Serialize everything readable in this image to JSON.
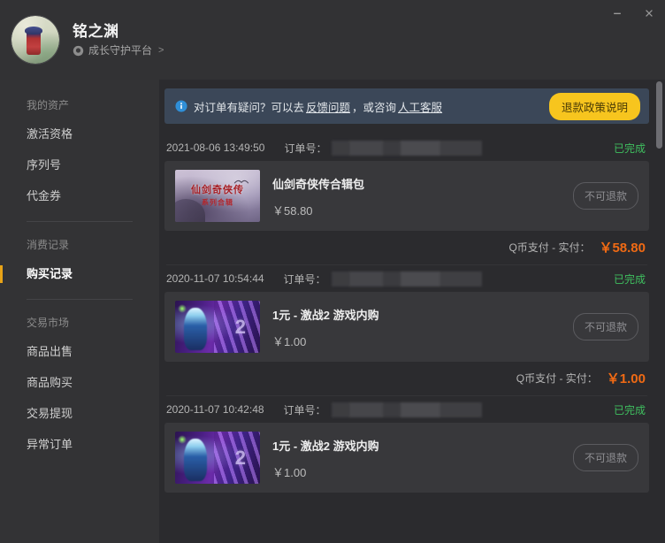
{
  "window": {
    "minimize_label": "–",
    "close_label": "✕"
  },
  "profile": {
    "nickname": "铭之渊",
    "platform_label": "成长守护平台",
    "platform_arrow": ">",
    "avatar_name": "user-avatar"
  },
  "sidebar": {
    "groups": [
      {
        "heading": "我的资产",
        "items": [
          {
            "label": "激活资格",
            "active": false
          },
          {
            "label": "序列号",
            "active": false
          },
          {
            "label": "代金券",
            "active": false
          }
        ]
      },
      {
        "heading": "消费记录",
        "items": [
          {
            "label": "购买记录",
            "active": true
          }
        ]
      },
      {
        "heading": "交易市场",
        "items": [
          {
            "label": "商品出售",
            "active": false
          },
          {
            "label": "商品购买",
            "active": false
          },
          {
            "label": "交易提现",
            "active": false
          },
          {
            "label": "异常订单",
            "active": false
          }
        ]
      }
    ]
  },
  "banner": {
    "icon": "info-icon",
    "text_before": "对订单有疑问？可以去",
    "link1": "反馈问题",
    "text_middle": "，或咨询",
    "link2": "人工客服",
    "button_label": "退款政策说明"
  },
  "orders": {
    "order_no_label": "订单号：",
    "items": [
      {
        "time": "2021-08-06 13:49:50",
        "order_no": "",
        "status": "已完成",
        "thumb": "xianjian",
        "thumb_title": "仙剑奇侠传",
        "thumb_subtitle": "系列合辑",
        "product_name": "仙剑奇侠传合辑包",
        "price": "￥58.80",
        "refund_label": "不可退款",
        "pay_method": "Q币支付 - 实付：",
        "pay_total": "￥58.80"
      },
      {
        "time": "2020-11-07 10:54:44",
        "order_no": "",
        "status": "已完成",
        "thumb": "gw2",
        "thumb_logo": "2",
        "product_name": "1元 - 激战2 游戏内购",
        "price": "￥1.00",
        "refund_label": "不可退款",
        "pay_method": "Q币支付 - 实付：",
        "pay_total": "￥1.00"
      },
      {
        "time": "2020-11-07 10:42:48",
        "order_no": "",
        "status": "已完成",
        "thumb": "gw2",
        "thumb_logo": "2",
        "product_name": "1元 - 激战2 游戏内购",
        "price": "￥1.00",
        "refund_label": "不可退款",
        "pay_method": "Q币支付 - 实付：",
        "pay_total": "￥1.00"
      }
    ]
  },
  "colors": {
    "accent_orange": "#e8a317",
    "banner_button": "#f7c51e",
    "status_green": "#3fbf5f",
    "price_orange": "#f06a14",
    "banner_bg": "#3b4758",
    "sidebar_bg": "#333335",
    "main_bg": "#2b2b2e",
    "card_bg": "#38383b"
  }
}
